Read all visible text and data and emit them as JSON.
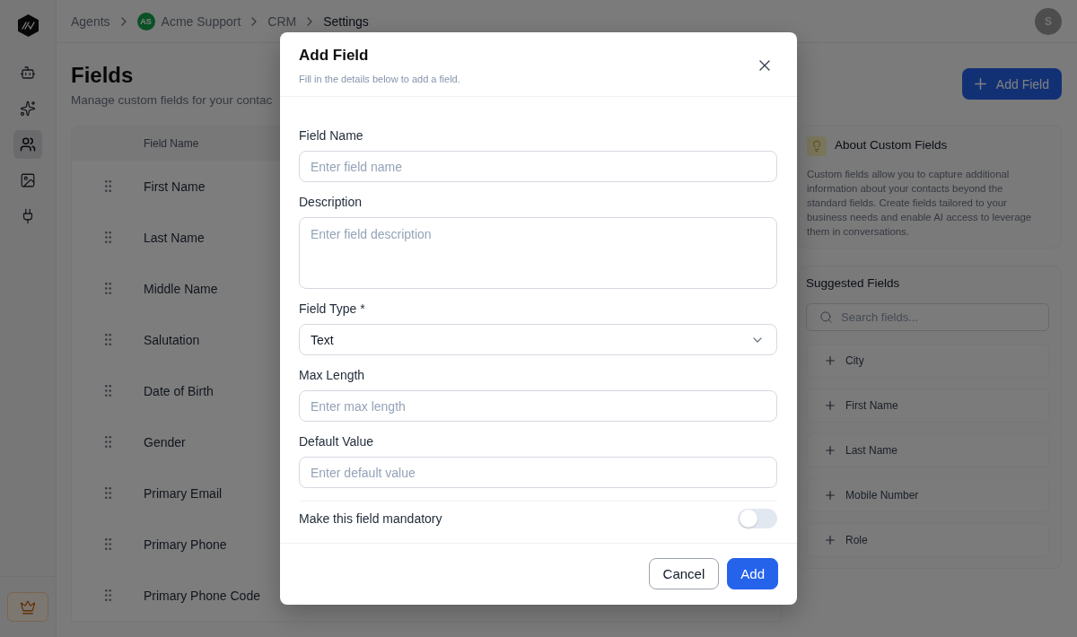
{
  "sidebar": {
    "items": [
      {
        "selected": false
      },
      {
        "selected": false
      },
      {
        "selected": true
      },
      {
        "selected": false
      },
      {
        "selected": false
      }
    ]
  },
  "breadcrumb": [
    {
      "label": "Agents",
      "current": false
    },
    {
      "label": "Acme Support",
      "badge": "AS",
      "current": false
    },
    {
      "label": "CRM",
      "current": false
    },
    {
      "label": "Settings",
      "current": true
    }
  ],
  "user_avatar": {
    "initial": "S"
  },
  "page": {
    "title": "Fields",
    "subtitle": "Manage custom fields for your contac",
    "add_button": "Add Field"
  },
  "table": {
    "columns": [
      "Field Name"
    ],
    "rows": [
      {
        "field_name": "First Name"
      },
      {
        "field_name": "Last Name"
      },
      {
        "field_name": "Middle Name"
      },
      {
        "field_name": "Salutation"
      },
      {
        "field_name": "Date of Birth"
      },
      {
        "field_name": "Gender"
      },
      {
        "field_name": "Primary Email"
      },
      {
        "field_name": "Primary Phone"
      },
      {
        "field_name": "Primary Phone Code"
      }
    ]
  },
  "about": {
    "title": "About Custom Fields",
    "text": "Custom fields allow you to capture additional information about your contacts beyond the standard fields. Create fields tailored to your business needs and enable AI access to leverage them in conversations."
  },
  "suggested": {
    "title": "Suggested Fields",
    "search": {
      "placeholder": "Search fields..."
    },
    "items": [
      "City",
      "First Name",
      "Last Name",
      "Mobile Number",
      "Role"
    ]
  },
  "dialog": {
    "title": "Add Field",
    "subtitle": "Fill in the details below to add a field.",
    "fields": [
      {
        "kind": "input",
        "label": "Field Name",
        "placeholder": "Enter field name"
      },
      {
        "kind": "textarea",
        "label": "Description",
        "placeholder": "Enter field description"
      },
      {
        "kind": "select",
        "label": "Field Type *",
        "value": "Text"
      },
      {
        "kind": "input",
        "label": "Max Length",
        "placeholder": "Enter max length"
      },
      {
        "kind": "input",
        "label": "Default Value",
        "placeholder": "Enter default value"
      }
    ],
    "mandatory": {
      "label": "Make this field mandatory",
      "on": false
    },
    "buttons": [
      {
        "kind": "secondary",
        "label": "Cancel"
      },
      {
        "kind": "primary",
        "label": "Add"
      }
    ]
  }
}
